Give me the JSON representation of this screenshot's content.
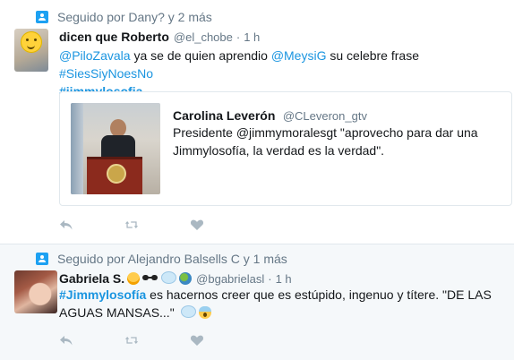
{
  "tweets": [
    {
      "context": "Seguido por Dany? y 2 más",
      "author_name": "dicen que Roberto",
      "author_handle": "@el_chobe",
      "separator": "·",
      "time": "1 h",
      "text": {
        "mention1": "@PiloZavala",
        "part1": " ya se de quien aprendio ",
        "mention2": "@MeysiG",
        "part2": " su celebre frase ",
        "hashtag1": "#SiesSiyNoesNo",
        "hashtag2": "#jimmylosofia"
      },
      "quote": {
        "author_name": "Carolina Leverón",
        "author_handle": "@CLeveron_gtv",
        "text": "Presidente @jimmymoralesgt \"aprovecho para dar una Jimmylosofía, la verdad es la verdad\"."
      }
    },
    {
      "context": "Seguido por Alejandro Balsells C y 1 más",
      "author_name": "Gabriela S.",
      "author_handle": "@bgabrielasl",
      "separator": "·",
      "time": "1 h",
      "text": {
        "hashtag1": "#Jimmylosofía",
        "part1": " es hacernos creer que es estúpido,  ingenuo y títere. \"DE LAS AGUAS MANSAS...\""
      }
    }
  ],
  "icons": {
    "context": "person-follow-icon",
    "reply": "reply-icon",
    "retweet": "retweet-icon",
    "like": "heart-icon"
  },
  "colors": {
    "link": "#1b95e0",
    "muted": "#657786",
    "action": "#aab8c2",
    "follow_badge": "#1da1f2"
  }
}
